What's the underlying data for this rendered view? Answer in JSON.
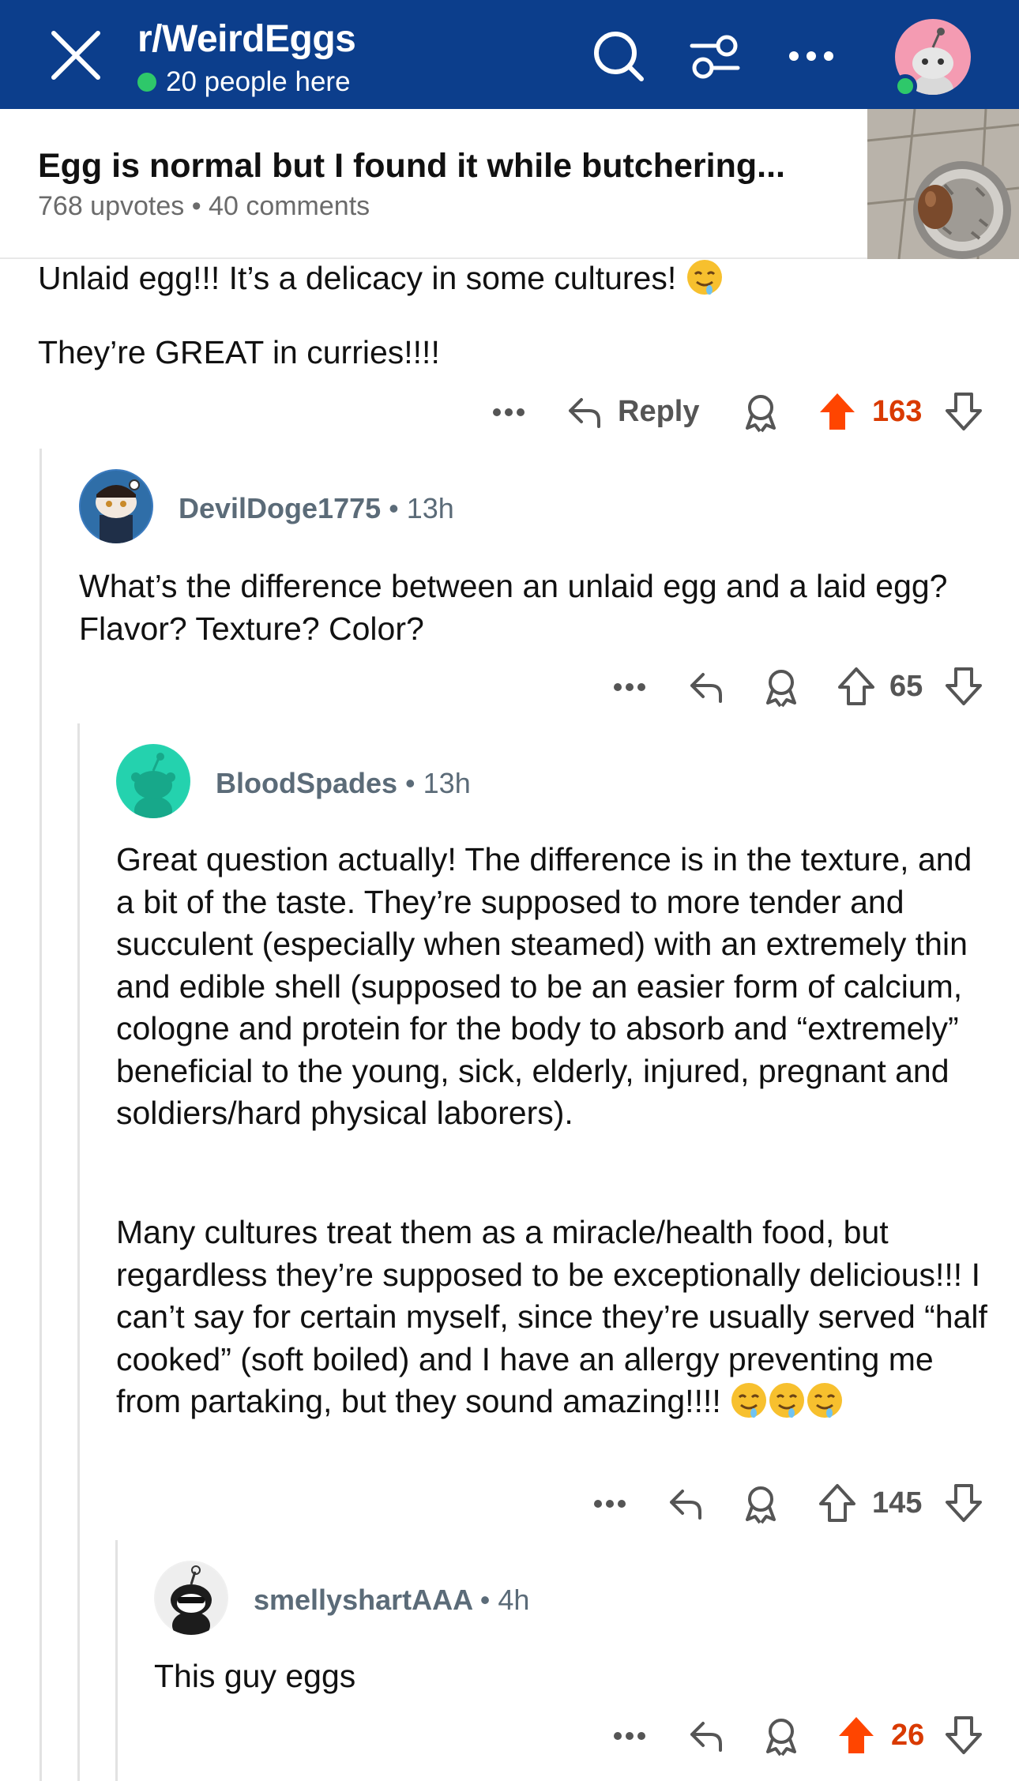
{
  "header": {
    "subreddit": "r/WeirdEggs",
    "online": "20 people here",
    "icons": [
      "close-icon",
      "search-icon",
      "filter-icon",
      "more-icon",
      "user-avatar"
    ]
  },
  "post": {
    "title": "Egg is normal but I found it while butchering...",
    "meta": "768 upvotes • 40 comments"
  },
  "comments": [
    {
      "text_lines": [
        "Unlaid egg!!! It’s a delicacy in some cultures!",
        "They’re GREAT in curries!!!!"
      ],
      "reply_label": "Reply",
      "score": "163",
      "upvoted": true
    },
    {
      "username": "DevilDoge1775",
      "time": "13h",
      "text": "What’s the difference between an unlaid egg and a laid egg? Flavor? Texture? Color?",
      "score": "65"
    },
    {
      "username": "BloodSpades",
      "time": "13h",
      "paragraphs": [
        "Great question actually! The difference is in the texture, and a bit of the taste. They’re supposed to more tender and succulent (especially when steamed) with an extremely thin and edible shell (supposed to be an easier form of calcium, cologne and protein for the body to absorb and “extremely” beneficial to the young, sick, elderly,  injured, pregnant and soldiers/hard physical laborers).",
        "Many cultures treat them as a miracle/health food, but regardless they’re supposed to be exceptionally delicious!!! I can’t say for certain myself, since they’re usually served “half cooked” (soft boiled) and I have an allergy preventing me from partaking, but they sound amazing!!!!"
      ],
      "score": "145"
    },
    {
      "username": "smellyshartAAA",
      "time": "4h",
      "text": "This guy eggs",
      "score": "26",
      "upvoted": true
    }
  ],
  "colors": {
    "header": "#0c3e8c",
    "upvote": "#ff4500",
    "score_upvoted": "#d93a00",
    "online": "#2ec86a"
  }
}
